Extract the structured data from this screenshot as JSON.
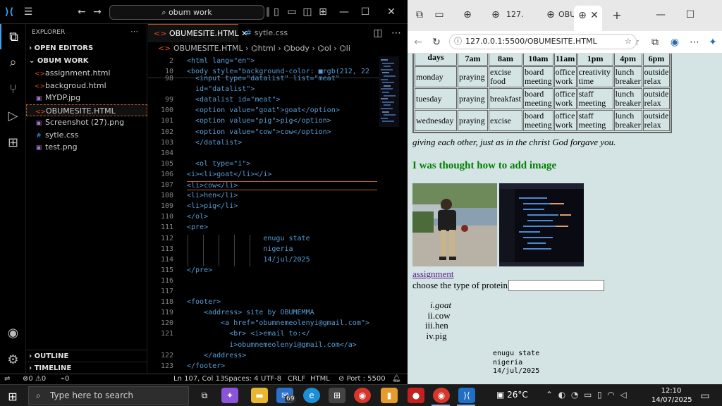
{
  "vscode": {
    "search_text": "obum work",
    "explorer_label": "EXPLORER",
    "open_editors": "OPEN EDITORS",
    "folder": "OBUM WORK",
    "files": [
      "assignment.html",
      "backgroud.html",
      "MYDP.jpg",
      "OBUMESITE.HTML",
      "Screenshot (27).png",
      "sytle.css",
      "test.png"
    ],
    "outline": "OUTLINE",
    "timeline": "TIMELINE",
    "tabs": [
      "OBUMESITE.HTML",
      "sytle.css"
    ],
    "breadcrumb": [
      "OBUMESITE.HTML",
      "html",
      "body",
      "ol",
      "li"
    ],
    "sticky_lines": [
      {
        "n": "2",
        "code": "<html lang=\"en\">"
      },
      {
        "n": "10",
        "code": "<body style=\"background-color: ■rgb(212, 22"
      }
    ],
    "lines": [
      {
        "n": "98",
        "code": "  <input type=\"datalist\" list=\"meat\""
      },
      {
        "n": "",
        "code": "  id=\"datalist\">"
      },
      {
        "n": "99",
        "code": "  <datalist id=\"meat\">"
      },
      {
        "n": "100",
        "code": "  <option value=\"goat\">goat</option>"
      },
      {
        "n": "101",
        "code": "  <option value=\"pig\">pig</option>"
      },
      {
        "n": "102",
        "code": "  <option value=\"cow\">cow</option>"
      },
      {
        "n": "103",
        "code": "  </datalist>"
      },
      {
        "n": "104",
        "code": ""
      },
      {
        "n": "105",
        "code": "  <ol type=\"i\">"
      },
      {
        "n": "106",
        "code": "<i><li>goat</li></i>"
      },
      {
        "n": "107",
        "code": "<li>cow</li>"
      },
      {
        "n": "108",
        "code": "<li>hen</li>"
      },
      {
        "n": "109",
        "code": "<li>pig</li>"
      },
      {
        "n": "110",
        "code": "</ol>"
      },
      {
        "n": "111",
        "code": "<pre>"
      },
      {
        "n": "112",
        "code": "                  enugu state"
      },
      {
        "n": "113",
        "code": "                  nigeria"
      },
      {
        "n": "114",
        "code": "                  14/jul/2025"
      },
      {
        "n": "115",
        "code": "</pre>"
      },
      {
        "n": "116",
        "code": ""
      },
      {
        "n": "117",
        "code": ""
      },
      {
        "n": "118",
        "code": "<footer>"
      },
      {
        "n": "119",
        "code": "    <address> site by OBUMEMMA"
      },
      {
        "n": "120",
        "code": "        <a href=\"obumnemeolenyi@gmail.com\">"
      },
      {
        "n": "121",
        "code": "          <br> <i>email to:</"
      },
      {
        "n": "",
        "code": "          i>obumnemeolenyi@gmail.com</a>"
      },
      {
        "n": "122",
        "code": "    </address>"
      },
      {
        "n": "123",
        "code": "</footer>"
      }
    ],
    "status": {
      "errors": "0",
      "warnings": "0",
      "ports": "0",
      "position": "Ln 107, Col 13",
      "spaces": "Spaces: 4",
      "encoding": "UTF-8",
      "eol": "CRLF",
      "language": "HTML",
      "port": "Port : 5500"
    }
  },
  "browser": {
    "tab1": "127.",
    "tab2": "OBU",
    "url": "127.0.0.1:5500/OBUMESITE.HTML"
  },
  "webpage": {
    "table": {
      "header": [
        "days",
        "7am",
        "8am",
        "10am",
        "11am",
        "1pm",
        "4pm",
        "6pm"
      ],
      "rows": [
        [
          "monday",
          "praying",
          "excise food",
          "board meeting",
          "office work",
          "creativity time",
          "lunch breaker",
          "outside relax"
        ],
        [
          "tuesday",
          "praying",
          "breakfast",
          "board meeting",
          "office work",
          "staff meeting",
          "lunch breaker",
          "outside relax"
        ],
        [
          "wednesday",
          "praying",
          "excise",
          "board meeting",
          "office work",
          "staff meeting",
          "lunch breaker",
          "outside relax"
        ]
      ]
    },
    "quote": "giving each other, just as in the christ God forgave you.",
    "heading": "I was thought how to add image",
    "link": "assignment",
    "protein_label": "choose the type of protein",
    "list": [
      "goat",
      "cow",
      "hen",
      "pig"
    ],
    "list_markers": [
      "i.",
      "ii.",
      "iii.",
      "iv."
    ],
    "pre": [
      "enugu state",
      "nigeria",
      "14/jul/2025"
    ]
  },
  "taskbar": {
    "search_placeholder": "Type here to search",
    "mail_badge": "69",
    "temperature": "26°C",
    "time": "12:10",
    "date": "14/07/2025"
  }
}
